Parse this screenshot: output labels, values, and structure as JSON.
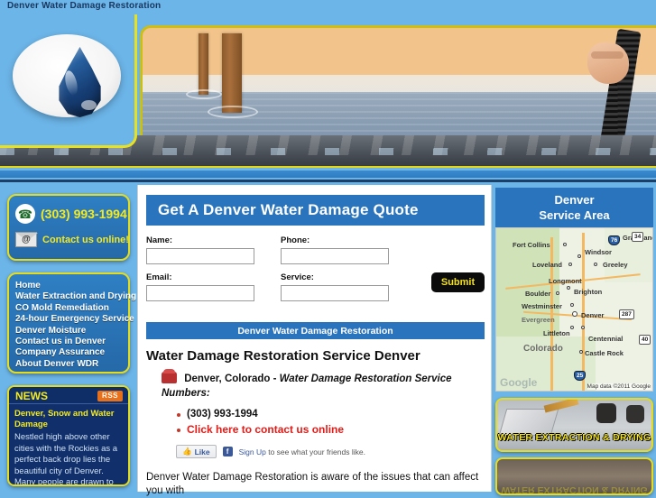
{
  "topbar": {
    "title": "Denver Water Damage Restoration"
  },
  "header": {
    "logo_alt": "water-drop-logo",
    "banner_alt": "wooden-posts-in-flood-water-with-vacuum-hose"
  },
  "sidebar": {
    "contact": {
      "phone": "(303) 993-1994",
      "phone_icon": "phone-icon",
      "email_label": "Contact us online!",
      "email_icon": "envelope-at-icon"
    },
    "nav_items": [
      {
        "label": "Home"
      },
      {
        "label": "Water Extraction and Drying"
      },
      {
        "label": "CO Mold Remediation"
      },
      {
        "label": "24-hour Emergency Service"
      },
      {
        "label": "Denver Moisture"
      },
      {
        "label": "Contact us in Denver"
      },
      {
        "label": "Company Assurance"
      },
      {
        "label": "About Denver WDR"
      }
    ],
    "news": {
      "heading": "NEWS",
      "rss_badge": "RSS",
      "item_title": "Denver, Snow and Water Damage",
      "item_text": "Nestled high above other cities with the Rockies as a perfect back drop lies the beautiful city of Denver. Many people are drawn to"
    }
  },
  "main": {
    "quote_heading": "Get A Denver Water Damage Quote",
    "form": {
      "name_label": "Name:",
      "name_value": "",
      "phone_label": "Phone:",
      "phone_value": "",
      "email_label": "Email:",
      "email_value": "",
      "service_label": "Service:",
      "service_value": "",
      "submit_label": "Submit"
    },
    "section_heading": "Denver Water Damage Restoration",
    "article_title": "Water Damage Restoration Service Denver",
    "lead_location": "Denver, Colorado - ",
    "lead_emphasis": "Water Damage Restoration Service Numbers:",
    "bullets": [
      {
        "text": "(303) 993-1994",
        "style": "normal"
      },
      {
        "text": "Click here to contact us online",
        "style": "red"
      }
    ],
    "facebook": {
      "like_label": "Like",
      "signup_label": "Sign Up",
      "after_text": " to see what your friends like."
    },
    "body_paragraph": "Denver Water Damage Restoration is aware of the issues that can affect you with"
  },
  "right": {
    "map_heading_line1": "Denver",
    "map_heading_line2": "Service Area",
    "map": {
      "cities": [
        {
          "name": "Fort Collins"
        },
        {
          "name": "Windsor"
        },
        {
          "name": "Greeley"
        },
        {
          "name": "Loveland"
        },
        {
          "name": "Longmont"
        },
        {
          "name": "Boulder"
        },
        {
          "name": "Brighton"
        },
        {
          "name": "Westminster"
        },
        {
          "name": "Denver"
        },
        {
          "name": "Evergreen"
        },
        {
          "name": "Littleton"
        },
        {
          "name": "Centennial"
        },
        {
          "name": "Castle Rock"
        },
        {
          "name": "Colorado"
        },
        {
          "name": "Grassland"
        }
      ],
      "highways": [
        "76",
        "34",
        "287",
        "40",
        "25"
      ],
      "watermark": "Google",
      "attribution": "Map data ©2011 Google"
    },
    "promos": [
      {
        "label": "WATER EXTRACTION & DRYING",
        "alt": "water-extraction-photo"
      },
      {
        "label": "",
        "alt": "mud-damage-photo"
      }
    ]
  },
  "colors": {
    "page_blue": "#6cb5e8",
    "panel_blue": "#2a74bd",
    "accent_yellow": "#e5dc1c",
    "link_red": "#e41b17",
    "news_navy": "#11306b"
  }
}
